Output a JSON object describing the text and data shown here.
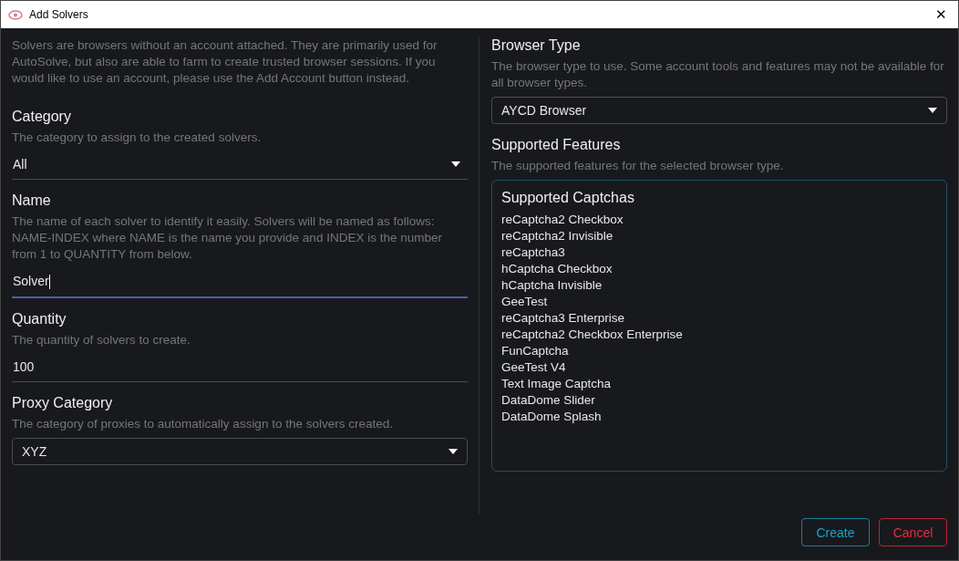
{
  "window": {
    "title": "Add Solvers",
    "close": "✕"
  },
  "intro": "Solvers are browsers without an account attached. They are primarily used for AutoSolve, but also are able to farm to create trusted browser sessions. If you would like to use an account, please use the Add Account button instead.",
  "left_fields": [
    {
      "kind": "underline-select",
      "label": "Category",
      "description": "The category to assign to the created solvers.",
      "value": "All"
    },
    {
      "kind": "text",
      "label": "Name",
      "description": "The name of each solver to identify it easily. Solvers will be named as follows: NAME-INDEX where NAME is the name you provide and INDEX is the number from 1 to QUANTITY from below.",
      "value": "Solver",
      "focused": true
    },
    {
      "kind": "text",
      "label": "Quantity",
      "description": "The quantity of solvers to create.",
      "value": "100",
      "focused": false
    },
    {
      "kind": "boxed-select",
      "label": "Proxy Category",
      "description": "The category of proxies to automatically assign to the solvers created.",
      "value": "XYZ"
    }
  ],
  "browser_type": {
    "label": "Browser Type",
    "description": "The browser type to use. Some account tools and features may not be available for all browser types.",
    "value": "AYCD Browser"
  },
  "supported_features": {
    "label": "Supported Features",
    "description": "The supported features for the selected browser type.",
    "heading": "Supported Captchas",
    "items": [
      "reCaptcha2 Checkbox",
      "reCaptcha2 Invisible",
      "reCaptcha3",
      "hCaptcha Checkbox",
      "hCaptcha Invisible",
      "GeeTest",
      "reCaptcha3 Enterprise",
      "reCaptcha2 Checkbox Enterprise",
      "FunCaptcha",
      "GeeTest V4",
      "Text Image Captcha",
      "DataDome Slider",
      "DataDome Splash"
    ]
  },
  "buttons": [
    {
      "kind": "primary",
      "label": "Create"
    },
    {
      "kind": "danger",
      "label": "Cancel"
    }
  ]
}
